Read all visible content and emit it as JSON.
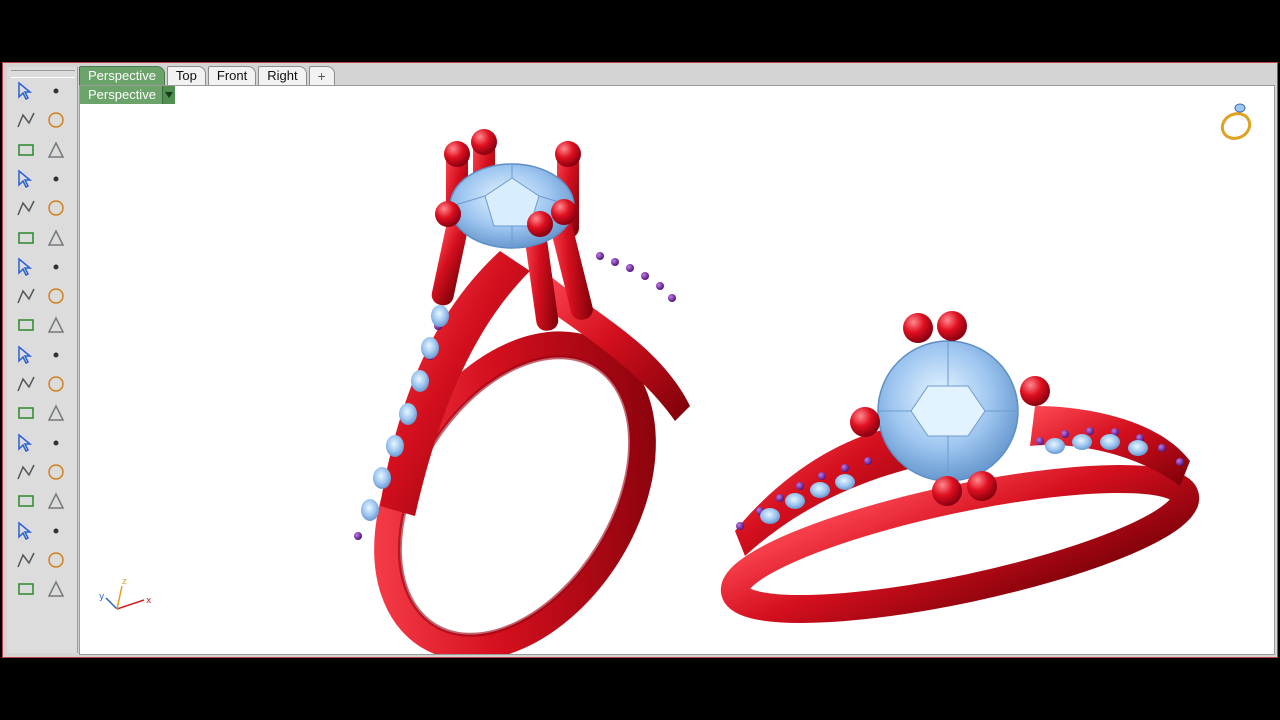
{
  "tabs": [
    {
      "label": "Perspective",
      "active": true
    },
    {
      "label": "Top",
      "active": false
    },
    {
      "label": "Front",
      "active": false
    },
    {
      "label": "Right",
      "active": false
    },
    {
      "label": "+",
      "active": false
    }
  ],
  "viewport": {
    "title": "Perspective"
  },
  "axes": {
    "x": "x",
    "y": "y",
    "z": "z"
  },
  "colors": {
    "accent": "#6ba36b",
    "metal": "#d40f1e",
    "gem": "#9ec6f0",
    "accent_stones": "#7a2aa8",
    "frame_border": "#c04040"
  },
  "tools": [
    "select-arrow-icon",
    "point-icon",
    "polyline-icon",
    "curve-icon",
    "circle-icon",
    "arc-icon",
    "polygon-icon",
    "rectangle-icon",
    "ellipse-icon",
    "fillet-curves-icon",
    "surface-from-points-icon",
    "loft-icon",
    "box-icon",
    "sphere-icon",
    "cylinder-icon",
    "planar-surface-icon",
    "gear-settings-icon",
    "explode-icon",
    "trim-icon",
    "split-icon",
    "boolean-union-icon",
    "boolean-difference-icon",
    "rotate-icon",
    "scale-icon",
    "text-icon",
    "transform-icon",
    "group-icon",
    "curve-edit-icon",
    "solid-tools-icon",
    "dimension-icon",
    "array-icon",
    "snap-icon",
    "project-icon",
    "check-icon",
    "shade-icon",
    "render-icon"
  ]
}
